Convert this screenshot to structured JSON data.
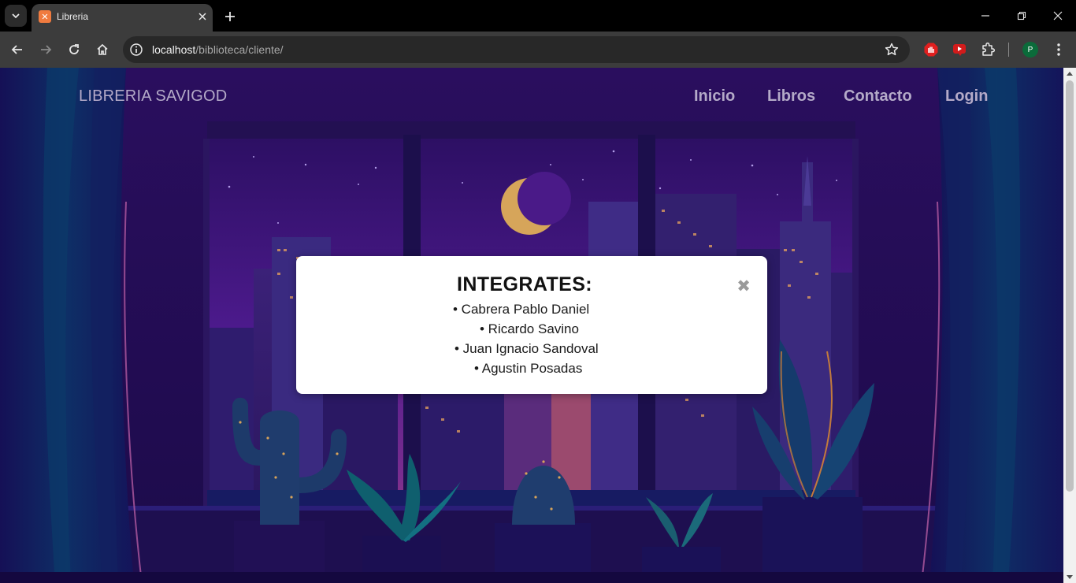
{
  "browser": {
    "tab": {
      "title": "Libreria",
      "favicon_icon": "xampp-icon"
    },
    "address": {
      "host": "localhost",
      "path": "/biblioteca/cliente/"
    },
    "profile_initial": "P",
    "extensions": [
      "adblock-icon",
      "youtube-extension-icon",
      "puzzle-icon"
    ],
    "colors": {
      "frame": "#000000",
      "toolbar": "#3c3c3c",
      "omnibox": "#282828"
    }
  },
  "site": {
    "brand": "LIBRERIA SAVIGOD",
    "nav": [
      "Inicio",
      "Libros",
      "Contacto",
      "Login"
    ],
    "colors": {
      "nav_text": "#b4aac8",
      "sky": "#3a1477"
    }
  },
  "modal": {
    "title": "INTEGRATES:",
    "members": [
      "• Cabrera Pablo Daniel",
      "• Ricardo Savino",
      "• Juan Ignacio Sandoval",
      "• Agustin Posadas"
    ]
  }
}
